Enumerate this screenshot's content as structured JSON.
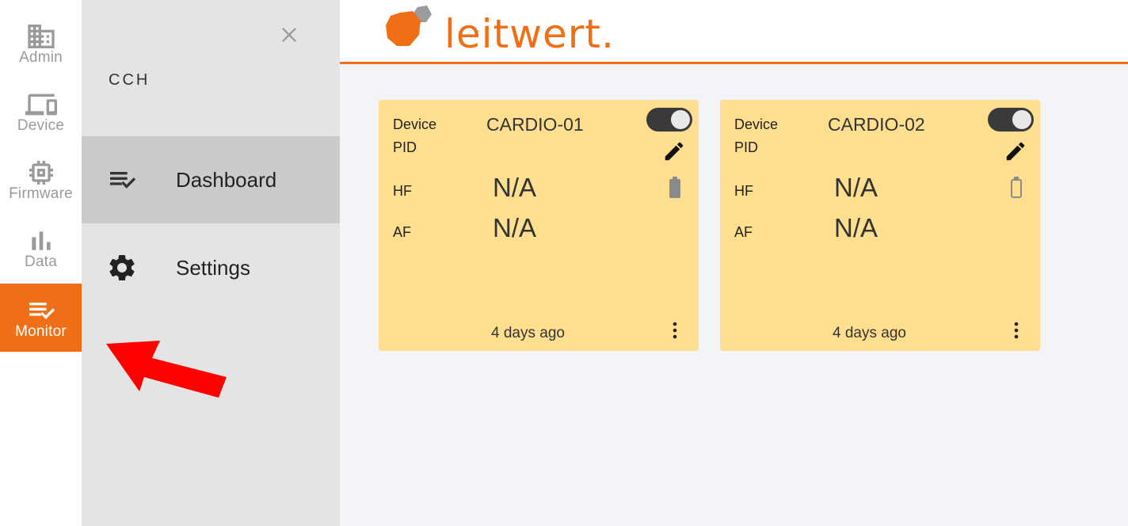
{
  "rail": {
    "items": [
      {
        "label": "Admin",
        "icon": "building-icon"
      },
      {
        "label": "Device",
        "icon": "devices-icon"
      },
      {
        "label": "Firmware",
        "icon": "chip-icon"
      },
      {
        "label": "Data",
        "icon": "bar-chart-icon"
      },
      {
        "label": "Monitor",
        "icon": "checklist-icon",
        "active": true
      }
    ]
  },
  "drawer": {
    "org": "CCH",
    "items": [
      {
        "label": "Dashboard",
        "icon": "checklist-icon",
        "selected": true
      },
      {
        "label": "Settings",
        "icon": "gear-icon"
      }
    ]
  },
  "header": {
    "logo_text": "leitwert."
  },
  "cards": [
    {
      "device_label": "Device",
      "device_name": "CARDIO-01",
      "pid_label": "PID",
      "hf_label": "HF",
      "hf_value": "N/A",
      "af_label": "AF",
      "af_value": "N/A",
      "time": "4 days ago",
      "enabled": true,
      "battery": "partial"
    },
    {
      "device_label": "Device",
      "device_name": "CARDIO-02",
      "pid_label": "PID",
      "hf_label": "HF",
      "hf_value": "N/A",
      "af_label": "AF",
      "af_value": "N/A",
      "time": "4 days ago",
      "enabled": true,
      "battery": "empty"
    }
  ],
  "colors": {
    "accent": "#ee6f16",
    "card": "#fddf8f",
    "arrow": "#ff0000"
  }
}
